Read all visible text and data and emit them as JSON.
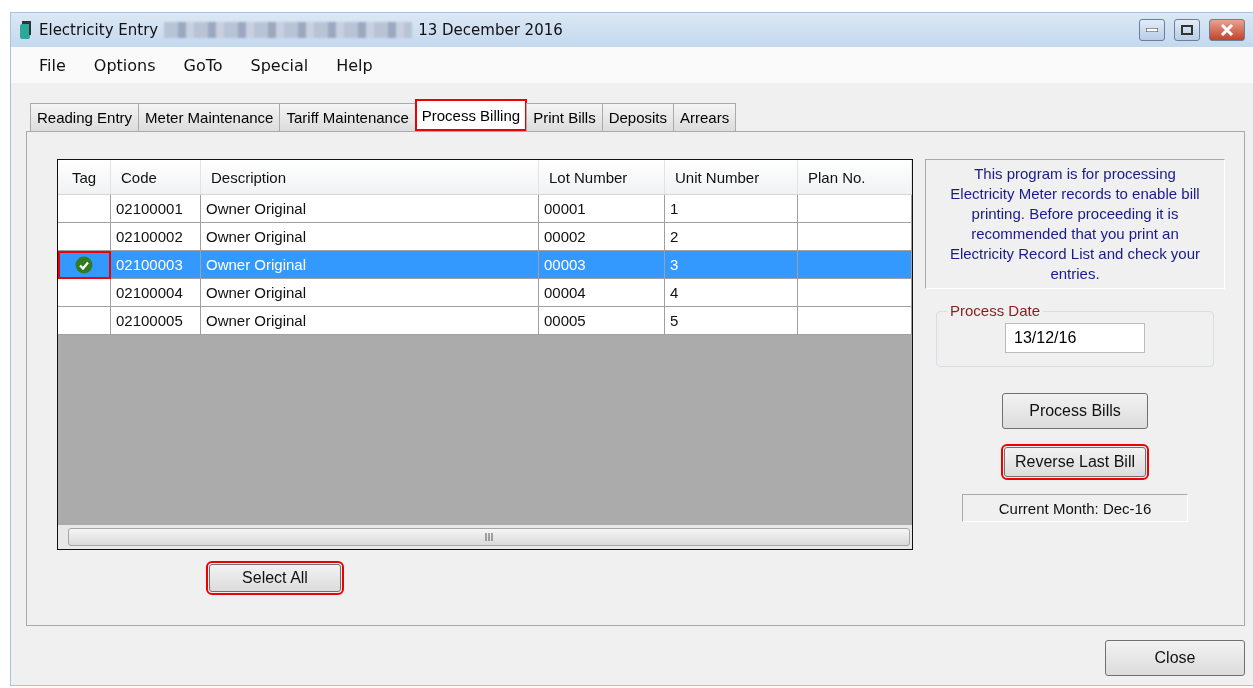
{
  "window": {
    "title": "Electricity Entry",
    "title_suffix": "13 December 2016",
    "redacted": true
  },
  "menu": [
    "File",
    "Options",
    "GoTo",
    "Special",
    "Help"
  ],
  "tabs": [
    {
      "label": "Reading Entry",
      "selected": false,
      "highlighted": false
    },
    {
      "label": "Meter Maintenance",
      "selected": false,
      "highlighted": false
    },
    {
      "label": "Tariff Maintenance",
      "selected": false,
      "highlighted": false
    },
    {
      "label": "Process Billing",
      "selected": true,
      "highlighted": true
    },
    {
      "label": "Print Bills",
      "selected": false,
      "highlighted": false
    },
    {
      "label": "Deposits",
      "selected": false,
      "highlighted": false
    },
    {
      "label": "Arrears",
      "selected": false,
      "highlighted": false
    }
  ],
  "table": {
    "columns": [
      "Tag",
      "Code",
      "Description",
      "Lot Number",
      "Unit Number",
      "Plan No."
    ],
    "rows": [
      {
        "tagged": false,
        "selected": false,
        "tag_highlighted": false,
        "code": "02100001",
        "description": "Owner Original",
        "lot_number": "00001",
        "unit_number": "1"
      },
      {
        "tagged": false,
        "selected": false,
        "tag_highlighted": false,
        "code": "02100002",
        "description": "Owner Original",
        "lot_number": "00002",
        "unit_number": "2"
      },
      {
        "tagged": true,
        "selected": true,
        "tag_highlighted": true,
        "code": "02100003",
        "description": "Owner Original",
        "lot_number": "00003",
        "unit_number": "3"
      },
      {
        "tagged": false,
        "selected": false,
        "tag_highlighted": false,
        "code": "02100004",
        "description": "Owner Original",
        "lot_number": "00004",
        "unit_number": "4"
      },
      {
        "tagged": false,
        "selected": false,
        "tag_highlighted": false,
        "code": "02100005",
        "description": "Owner Original",
        "lot_number": "00005",
        "unit_number": "5"
      }
    ]
  },
  "select_all_button": {
    "label": "Select All",
    "highlighted": true
  },
  "info_text": "This program is for processing Electricity Meter records to enable bill printing. Before proceeding it is recommended that you print an Electricity Record List and check your entries.",
  "process_date": {
    "label": "Process Date",
    "value": "13/12/16"
  },
  "process_bills_button": {
    "label": "Process Bills",
    "highlighted": false
  },
  "reverse_last_bill_button": {
    "label": "Reverse Last Bill",
    "highlighted": true
  },
  "current_month": "Current Month: Dec-16",
  "close_button": {
    "label": "Close",
    "highlighted": false
  }
}
